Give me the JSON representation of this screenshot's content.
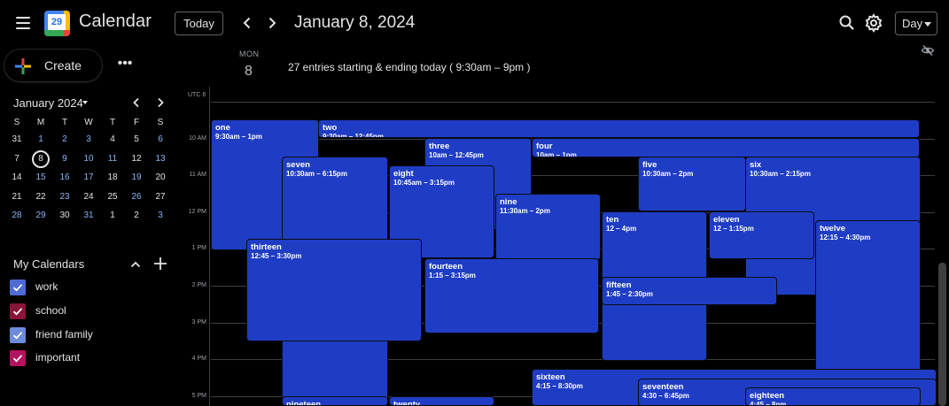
{
  "app": {
    "title": "Calendar",
    "logo_day": "29"
  },
  "toolbar": {
    "today_label": "Today",
    "date_title": "January 8, 2024",
    "view_label": "Day"
  },
  "sidebar": {
    "create_label": "Create",
    "more_label": "•••",
    "mini_calendar": {
      "title": "January 2024",
      "weekday_headers": [
        "S",
        "M",
        "T",
        "W",
        "T",
        "F",
        "S"
      ],
      "weeks": [
        [
          "31",
          "1",
          "2",
          "3",
          "4",
          "5",
          "6"
        ],
        [
          "7",
          "8",
          "9",
          "10",
          "11",
          "12",
          "13"
        ],
        [
          "14",
          "15",
          "16",
          "17",
          "18",
          "19",
          "20"
        ],
        [
          "21",
          "22",
          "23",
          "24",
          "25",
          "26",
          "27"
        ],
        [
          "28",
          "29",
          "30",
          "31",
          "1",
          "2",
          "3"
        ]
      ],
      "today": "8"
    },
    "my_calendars": {
      "title": "My Calendars",
      "items": [
        {
          "label": "work",
          "color": "#4f6bd8"
        },
        {
          "label": "school",
          "color": "#8a1538"
        },
        {
          "label": "friend family",
          "color": "#6d8bdb"
        },
        {
          "label": "important",
          "color": "#b5125f"
        }
      ]
    }
  },
  "day_header": {
    "weekday": "MON",
    "day_number": "8",
    "summary": "27 entries starting & ending today ( 9:30am – 9pm )",
    "timezone": "UTC 6"
  },
  "hour_labels": [
    "10 AM",
    "11 AM",
    "12 PM",
    "1 PM",
    "2 PM",
    "3 PM",
    "4 PM",
    "5 PM"
  ],
  "event_color": "#1f3dc4",
  "events": [
    {
      "title": "one",
      "time": "9:30am – 1pm"
    },
    {
      "title": "two",
      "time": "9:30am – 12:45pm"
    },
    {
      "title": "three",
      "time": "10am – 12:45pm"
    },
    {
      "title": "four",
      "time": "10am – 1pm"
    },
    {
      "title": "five",
      "time": "10:30am – 2pm"
    },
    {
      "title": "six",
      "time": "10:30am – 2:15pm"
    },
    {
      "title": "seven",
      "time": "10:30am – 6:15pm"
    },
    {
      "title": "eight",
      "time": "10:45am – 3:15pm"
    },
    {
      "title": "nine",
      "time": "11:30am – 2pm"
    },
    {
      "title": "ten",
      "time": "12 – 4pm"
    },
    {
      "title": "eleven",
      "time": "12 – 1:15pm"
    },
    {
      "title": "twelve",
      "time": "12:15 – 4:30pm"
    },
    {
      "title": "thirteen",
      "time": "12:45 – 3:30pm"
    },
    {
      "title": "fourteen",
      "time": "1:15 – 3:15pm"
    },
    {
      "title": "fifteen",
      "time": "1:45 – 2:30pm"
    },
    {
      "title": "sixteen",
      "time": "4:15 – 8:30pm"
    },
    {
      "title": "seventeen",
      "time": "4:30 – 6:45pm"
    },
    {
      "title": "eighteen",
      "time": "4:45 – 8pm"
    },
    {
      "title": "nineteen",
      "time": ""
    },
    {
      "title": "twenty",
      "time": ""
    }
  ]
}
